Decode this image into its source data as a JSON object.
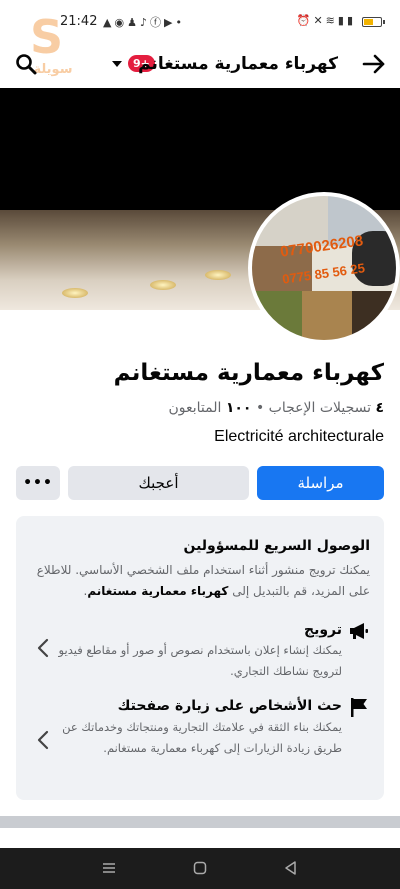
{
  "status_bar": {
    "time": "21:42",
    "left_icons": [
      "notification-icon",
      "messenger-icon",
      "snapchat-icon",
      "tiktok-icon",
      "facebook-icon",
      "youtube-icon",
      "more-dot-icon"
    ],
    "right_icons": [
      "alarm-icon",
      "mute-icon",
      "wifi-icon",
      "signal-icon"
    ]
  },
  "watermark": {
    "letter": "S",
    "text": "سويلة"
  },
  "header": {
    "page_name": "كهرباء معمارية مستغانم",
    "badge": "9+"
  },
  "avatar": {
    "phone_1": "0770026208",
    "phone_2": "0775 85 56 25"
  },
  "profile": {
    "title": "كهرباء معمارية مستغانم",
    "likes_count": "٤",
    "likes_label": "تسجيلات الإعجاب",
    "separator": "•",
    "followers_count": "١٠٠",
    "followers_label": "المتابعون",
    "description": "Electricité architecturale"
  },
  "buttons": {
    "message": "مراسلة",
    "like": "أعجبك",
    "more": "•••"
  },
  "quick_access": {
    "title": "الوصول السريع للمسؤولين",
    "body_text": "يمكنك ترويج منشور أثناء استخدام ملف الشخصي الأساسي. للاطلاع على المزيد، قم بالتبديل إلى",
    "body_link": "كهرباء معمارية مستغانم",
    "body_end": ".",
    "items": [
      {
        "title": "ترويج",
        "desc": "يمكنك إنشاء إعلان باستخدام نصوص أو صور أو مقاطع فيديو لترويج نشاطك التجاري.",
        "icon": "megaphone-icon"
      },
      {
        "title": "حث الأشخاص على زيارة صفحتك",
        "desc": "يمكنك بناء الثقة في علامتك التجارية ومنتجاتك وخدماتك عن طريق زيادة الزيارات إلى كهرباء معمارية مستغانم.",
        "icon": "flag-icon"
      }
    ]
  },
  "colors": {
    "primary": "#1877f2",
    "button_gray": "#e4e6eb",
    "card_bg": "#f0f2f5",
    "badge": "#e41e3f"
  }
}
